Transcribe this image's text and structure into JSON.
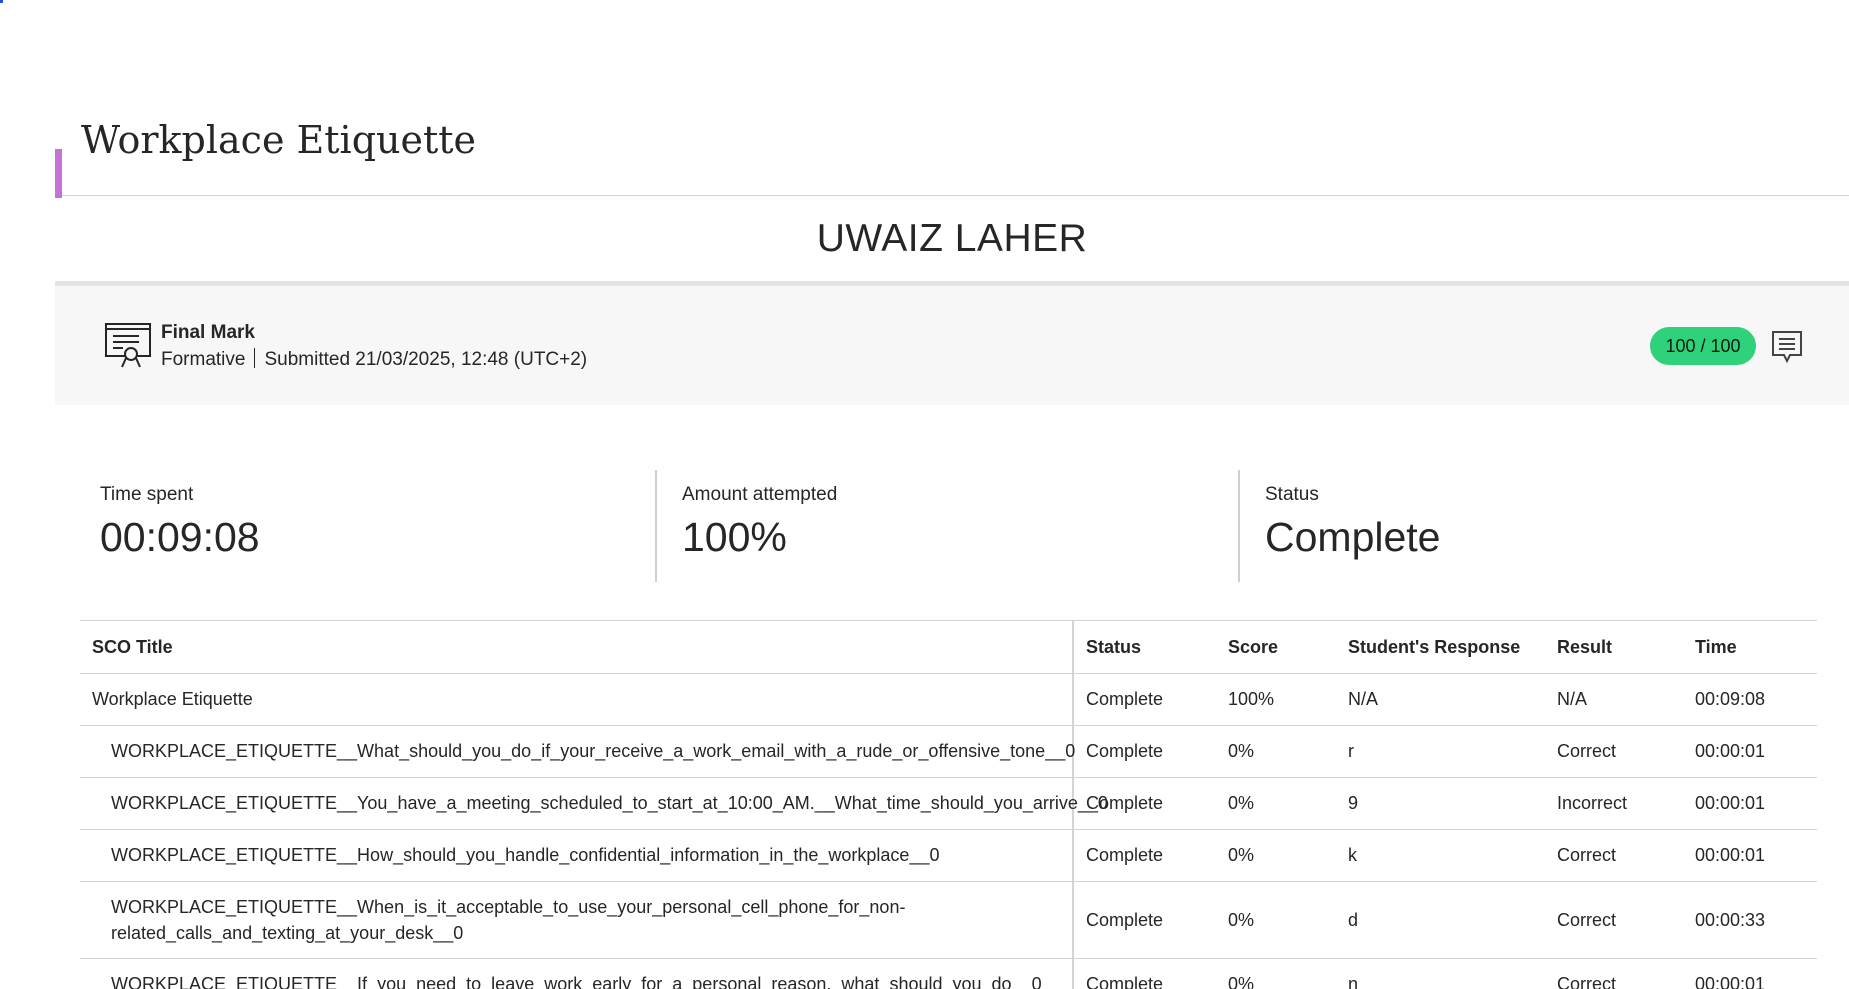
{
  "page_title": "Workplace Etiquette",
  "student_name": "UWAIZ LAHER",
  "final_mark": {
    "label": "Final Mark",
    "type": "Formative",
    "submitted": "Submitted 21/03/2025, 12:48 (UTC+2)",
    "score": "100 / 100",
    "icon": "certificate-icon",
    "comment_icon": "comment-icon",
    "score_color": "#2fd17a"
  },
  "stats": {
    "time_spent": {
      "label": "Time spent",
      "value": "00:09:08"
    },
    "amount_attempted": {
      "label": "Amount attempted",
      "value": "100%"
    },
    "status": {
      "label": "Status",
      "value": "Complete"
    }
  },
  "table": {
    "headers": [
      "SCO Title",
      "Status",
      "Score",
      "Student's Response",
      "Result",
      "Time"
    ],
    "rows": [
      [
        "Workplace Etiquette",
        "Complete",
        "100%",
        "N/A",
        "N/A",
        "00:09:08"
      ],
      [
        "WORKPLACE_ETIQUETTE__What_should_you_do_if_your_receive_a_work_email_with_a_rude_or_offensive_tone__0",
        "Complete",
        "0%",
        "r",
        "Correct",
        "00:00:01"
      ],
      [
        "WORKPLACE_ETIQUETTE__You_have_a_meeting_scheduled_to_start_at_10:00_AM.__What_time_should_you_arrive__0",
        "Complete",
        "0%",
        "9",
        "Incorrect",
        "00:00:01"
      ],
      [
        "WORKPLACE_ETIQUETTE__How_should_you_handle_confidential_information_in_the_workplace__0",
        "Complete",
        "0%",
        "k",
        "Correct",
        "00:00:01"
      ],
      [
        "WORKPLACE_ETIQUETTE__When_is_it_acceptable_to_use_your_personal_cell_phone_for_non-related_calls_and_texting_at_your_desk__0",
        "Complete",
        "0%",
        "d",
        "Correct",
        "00:00:33"
      ],
      [
        "WORKPLACE_ETIQUETTE__If_you_need_to_leave_work_early_for_a_personal_reason,_what_should_you_do__0",
        "Complete",
        "0%",
        "n",
        "Correct",
        "00:00:01"
      ]
    ]
  },
  "colors": {
    "accent": "#c373d6",
    "score_pill": "#2fd17a",
    "panel_bg": "#f7f7f7"
  }
}
